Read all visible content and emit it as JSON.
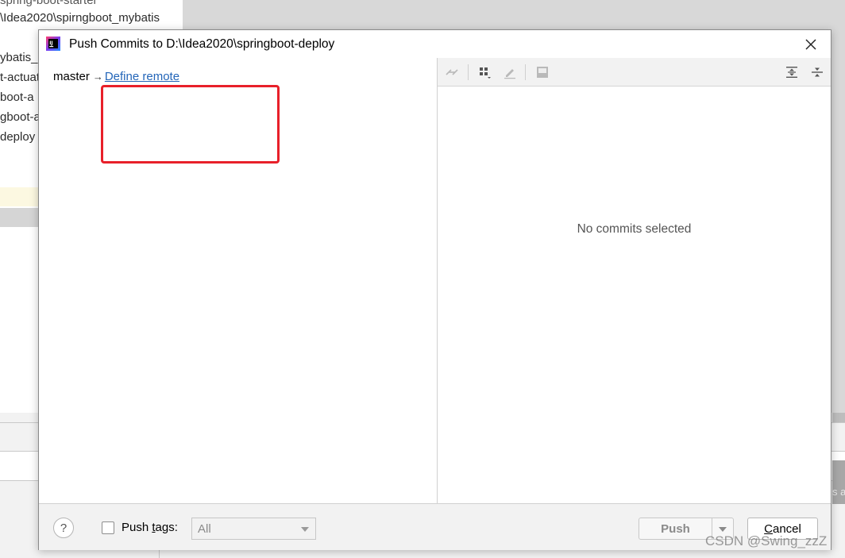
{
  "background": {
    "project_items": [
      "spring-boot-starter",
      "\\Idea2020\\spirngboot_mybatis",
      "ybatis_c",
      "t-actuat",
      "boot-a",
      "gboot-a",
      "deploy"
    ],
    "right_edge_text": "s a"
  },
  "dialog": {
    "title": "Push Commits to D:\\Idea2020\\springboot-deploy",
    "branch": "master",
    "arrow": "→",
    "define_remote_link": "Define remote",
    "empty_message": "No commits selected",
    "footer": {
      "help": "?",
      "push_tags_prefix": "Push ",
      "push_tags_mnemonic": "t",
      "push_tags_suffix": "ags:",
      "tags_value": "All",
      "push_label": "Push",
      "cancel_mnemonic": "C",
      "cancel_rest": "ancel"
    }
  },
  "watermark": "CSDN @Swing_zzZ",
  "colors": {
    "link": "#2365b8",
    "annotation": "#e8202a"
  }
}
